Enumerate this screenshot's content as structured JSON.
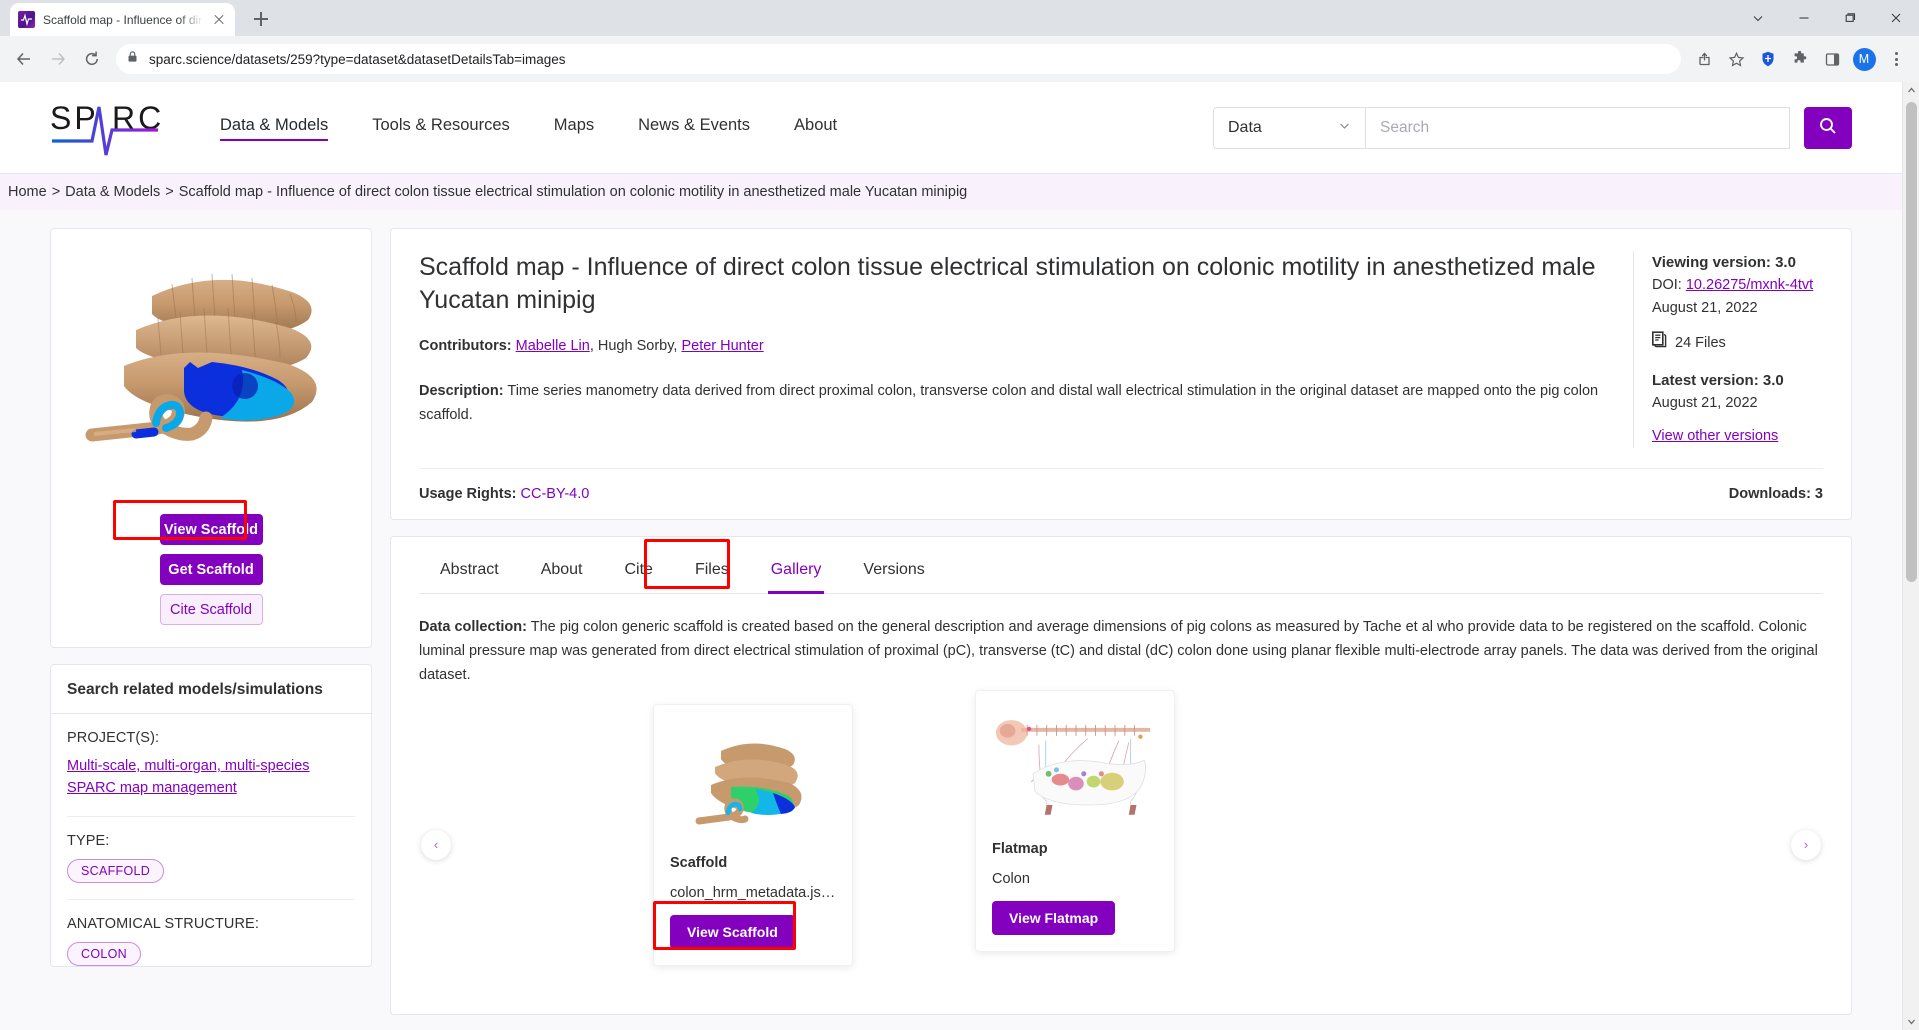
{
  "browser": {
    "tab_title": "Scaffold map - Influence of direc",
    "favicon_name": "sparc-favicon",
    "new_tab_label": "+",
    "url": "sparc.science/datasets/259?type=dataset&datasetDetailsTab=images",
    "avatar_initial": "M",
    "toolbar_icons": [
      "back-arrow",
      "forward-arrow",
      "reload",
      "lock",
      "share",
      "bookmark-star",
      "shield-extension",
      "puzzle-extension",
      "sidepanel",
      "profile-avatar",
      "kebab-menu"
    ],
    "window_controls": [
      "minimize-chevron",
      "minimize",
      "maximize",
      "close"
    ]
  },
  "header": {
    "logo_text": "SPARC",
    "nav": [
      {
        "label": "Data & Models",
        "active": true
      },
      {
        "label": "Tools & Resources",
        "active": false
      },
      {
        "label": "Maps",
        "active": false
      },
      {
        "label": "News & Events",
        "active": false
      },
      {
        "label": "About",
        "active": false
      }
    ],
    "search": {
      "category_value": "Data",
      "placeholder": "Search",
      "value": "",
      "button_icon": "search-icon"
    }
  },
  "breadcrumb": {
    "items": [
      "Home",
      "Data & Models",
      "Scaffold map - Influence of direct colon tissue electrical stimulation on colonic motility in anesthetized male Yucatan minipig"
    ],
    "separator": ">"
  },
  "sidebar": {
    "scaffold_preview_alt": "pig-colon-scaffold-thumbnail",
    "buttons": [
      {
        "label": "View Scaffold",
        "style": "primary",
        "highlighted": true
      },
      {
        "label": "Get Scaffold",
        "style": "primary",
        "highlighted": false
      },
      {
        "label": "Cite Scaffold",
        "style": "ghost",
        "highlighted": false
      }
    ],
    "related": {
      "title": "Search related models/simulations",
      "facets": [
        {
          "label": "PROJECT(S):",
          "type": "links",
          "values": [
            "Multi-scale, multi-organ, multi-species SPARC map management"
          ]
        },
        {
          "label": "TYPE:",
          "type": "pills",
          "values": [
            "SCAFFOLD"
          ]
        },
        {
          "label": "ANATOMICAL STRUCTURE:",
          "type": "pills",
          "values": [
            "COLON"
          ]
        }
      ]
    }
  },
  "dataset": {
    "title": "Scaffold map - Influence of direct colon tissue electrical stimulation on colonic motility in anesthetized male Yucatan minipig",
    "contributors_label": "Contributors:",
    "contributors": [
      {
        "name": "Mabelle Lin",
        "link": true
      },
      {
        "name": "Hugh Sorby",
        "link": false
      },
      {
        "name": "Peter Hunter",
        "link": true
      }
    ],
    "description_label": "Description:",
    "description": "Time series manometry data derived from direct proximal colon, transverse colon and distal wall electrical stimulation in the original dataset are mapped onto the pig colon scaffold.",
    "usage_rights_label": "Usage Rights:",
    "usage_rights_value": "CC-BY-4.0",
    "downloads": "Downloads: 3",
    "version": {
      "viewing_version": "Viewing version: 3.0",
      "doi_label": "DOI:",
      "doi_value": "10.26275/mxnk-4tvt",
      "viewing_date": "August 21, 2022",
      "files_count": "24 Files",
      "files_icon": "files-icon",
      "latest_version": "Latest version: 3.0",
      "latest_date": "August 21, 2022",
      "other_versions_link": "View other versions"
    }
  },
  "tabs": [
    {
      "label": "Abstract",
      "active": false
    },
    {
      "label": "About",
      "active": false
    },
    {
      "label": "Cite",
      "active": false
    },
    {
      "label": "Files",
      "active": false
    },
    {
      "label": "Gallery",
      "active": true,
      "highlighted": true
    },
    {
      "label": "Versions",
      "active": false
    }
  ],
  "gallery": {
    "collection_label": "Data collection:",
    "collection_text": "The pig colon generic scaffold is created based on the general description and average dimensions of pig colons as measured by Tache et al who provide data to be registered on the scaffold. Colonic luminal pressure map was generated from direct electrical stimulation of proximal (pC), transverse (tC) and distal (dC) colon done using planar flexible multi-electrode array panels. The data was derived from the original dataset.",
    "prev_arrow": "‹",
    "next_arrow": "›",
    "cards": [
      {
        "title": "Scaffold",
        "subtitle": "colon_hrm_metadata.js…",
        "button": "View Scaffold",
        "thumb": "scaffold-thumb",
        "highlighted": true
      },
      {
        "title": "Flatmap",
        "subtitle": "Colon",
        "button": "View Flatmap",
        "thumb": "flatmap-thumb",
        "highlighted": false
      }
    ]
  },
  "colors": {
    "brand_purple": "#8300bf",
    "highlight_red": "#ff0000",
    "breadcrumb_bg": "#f9f2fc",
    "page_bg": "#f9f9fb"
  }
}
